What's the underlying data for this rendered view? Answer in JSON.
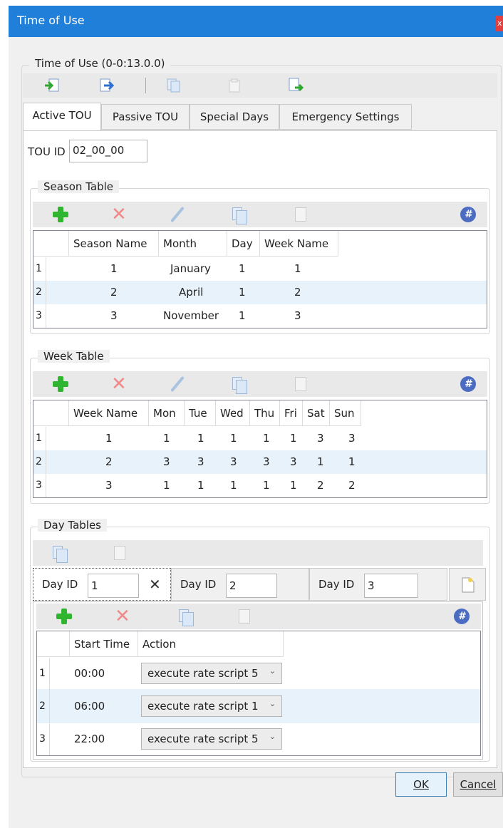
{
  "window": {
    "title": "Time of Use",
    "close_label": "x"
  },
  "group_title": "Time of Use (0-0:13.0.0)",
  "tabs": [
    {
      "label": "Active TOU"
    },
    {
      "label": "Passive TOU"
    },
    {
      "label": "Special Days"
    },
    {
      "label": "Emergency Settings"
    }
  ],
  "tou": {
    "label": "TOU ID",
    "value": "02_00_00"
  },
  "season": {
    "title": "Season Table",
    "headers": [
      "Season Name",
      "Month",
      "Day",
      "Week Name"
    ],
    "rows": [
      {
        "n": "1",
        "season": "1",
        "month": "January",
        "day": "1",
        "week": "1"
      },
      {
        "n": "2",
        "season": "2",
        "month": "April",
        "day": "1",
        "week": "2"
      },
      {
        "n": "3",
        "season": "3",
        "month": "November",
        "day": "1",
        "week": "3"
      }
    ]
  },
  "week": {
    "title": "Week Table",
    "headers": [
      "Week Name",
      "Mon",
      "Tue",
      "Wed",
      "Thu",
      "Fri",
      "Sat",
      "Sun"
    ],
    "rows": [
      {
        "n": "1",
        "name": "1",
        "mon": "1",
        "tue": "1",
        "wed": "1",
        "thu": "1",
        "fri": "1",
        "sat": "3",
        "sun": "3"
      },
      {
        "n": "2",
        "name": "2",
        "mon": "3",
        "tue": "3",
        "wed": "3",
        "thu": "3",
        "fri": "3",
        "sat": "1",
        "sun": "1"
      },
      {
        "n": "3",
        "name": "3",
        "mon": "1",
        "tue": "1",
        "wed": "1",
        "thu": "1",
        "fri": "1",
        "sat": "2",
        "sun": "2"
      }
    ]
  },
  "day": {
    "title": "Day Tables",
    "ids": [
      {
        "label": "Day ID",
        "value": "1"
      },
      {
        "label": "Day ID",
        "value": "2"
      },
      {
        "label": "Day ID",
        "value": "3"
      }
    ],
    "remove_glyph": "✕",
    "headers": [
      "Start Time",
      "Action"
    ],
    "rows": [
      {
        "n": "1",
        "time": "00:00",
        "action": "execute rate script 5"
      },
      {
        "n": "2",
        "time": "06:00",
        "action": "execute rate script 1"
      },
      {
        "n": "3",
        "time": "22:00",
        "action": "execute rate script 5"
      }
    ]
  },
  "icons": {
    "hash": "#",
    "delete": "✕",
    "chevron": "⌄"
  },
  "buttons": {
    "ok": "OK",
    "cancel": "Cancel"
  },
  "colors": {
    "titlebar": "#1f7fd9",
    "alt_row": "#e8f2fb",
    "add": "#2fb52f"
  }
}
